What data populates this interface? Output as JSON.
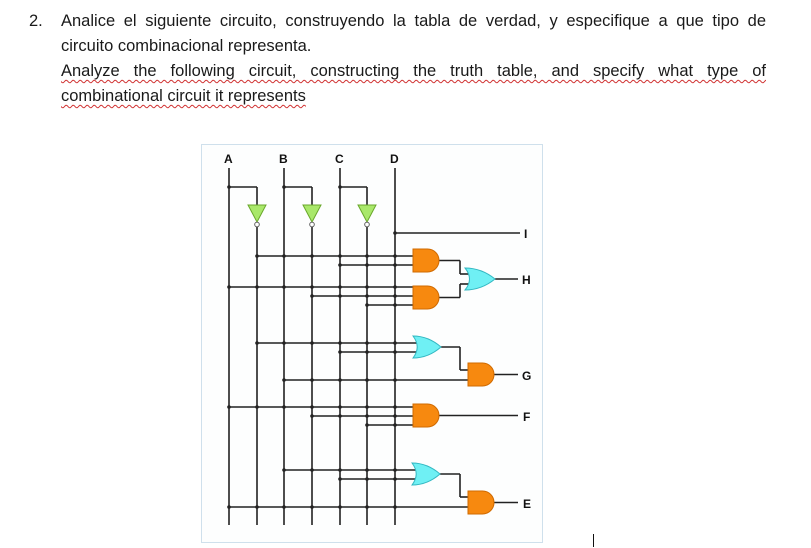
{
  "question": {
    "number": "2.",
    "spanish_line1": "Analice el siguiente circuito, construyendo la tabla de verdad, y especifique a que tipo de",
    "spanish_line2": "circuito combinacional representa.",
    "english_line1": "Analyze the following circuit, constructing the truth table, and specify what type of",
    "english_line2": "combinational circuit it represents"
  },
  "circuit": {
    "inputs": [
      "A",
      "B",
      "C",
      "D"
    ],
    "outputs": [
      "I",
      "H",
      "G",
      "F",
      "E"
    ],
    "colors": {
      "and_gate": "#f7890f",
      "or_gate": "#6ff0f4",
      "not_gate": "#a9e86a",
      "wire": "#222222"
    },
    "gates": [
      {
        "type": "NOT",
        "input": "A"
      },
      {
        "type": "NOT",
        "input": "B"
      },
      {
        "type": "NOT",
        "input": "C"
      },
      {
        "type": "AND",
        "inputs": [
          "A'",
          "C"
        ],
        "to": "OR-H"
      },
      {
        "type": "AND",
        "inputs": [
          "A",
          "B",
          "C'"
        ],
        "to": "OR-H"
      },
      {
        "type": "OR",
        "inputs": [
          "AND1",
          "AND2"
        ],
        "output": "H"
      },
      {
        "type": "OR",
        "inputs": [
          "A'",
          "C"
        ],
        "to": "AND-G"
      },
      {
        "type": "AND",
        "inputs": [
          "OR-G",
          "B"
        ],
        "output": "G"
      },
      {
        "type": "AND",
        "inputs": [
          "A",
          "B'",
          "C'"
        ],
        "output": "F"
      },
      {
        "type": "OR",
        "inputs": [
          "B",
          "C"
        ],
        "to": "AND-E"
      },
      {
        "type": "AND",
        "inputs": [
          "OR-E",
          "A"
        ],
        "output": "E"
      },
      {
        "type": "WIRE",
        "input": "D",
        "output": "I"
      }
    ]
  }
}
